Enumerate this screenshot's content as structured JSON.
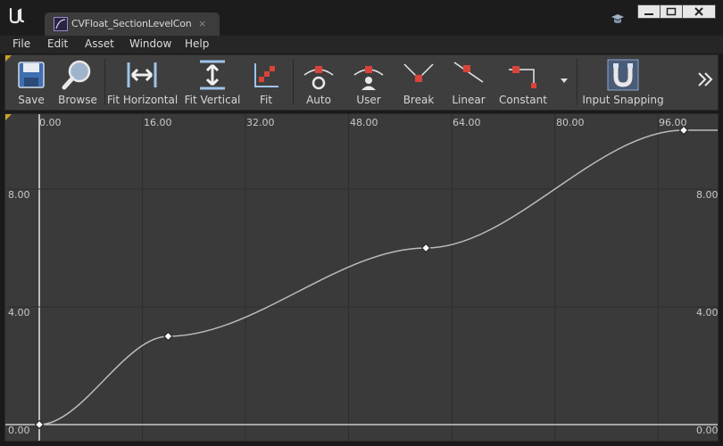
{
  "window": {
    "tab_title": "CVFloat_SectionLevelCon",
    "tab_close": "×"
  },
  "menu": [
    "File",
    "Edit",
    "Asset",
    "Window",
    "Help"
  ],
  "toolbar": {
    "save": "Save",
    "browse": "Browse",
    "fit_horizontal": "Fit Horizontal",
    "fit_vertical": "Fit Vertical",
    "fit": "Fit",
    "auto": "Auto",
    "user": "User",
    "break": "Break",
    "linear": "Linear",
    "constant": "Constant",
    "input_snapping": "Input Snapping"
  },
  "icons": {
    "logo": "unreal-logo-icon",
    "asset": "curve-asset-icon",
    "hat": "graduation-cap-icon",
    "overflow": "chevron-double-right-icon"
  },
  "colors": {
    "curve": "#bcbcbc",
    "grid": "#2e2e2e",
    "key_fill": "#ffffff",
    "accent": "#c9a227"
  },
  "chart_data": {
    "type": "line",
    "x_ticks": [
      "0.00",
      "16.00",
      "32.00",
      "48.00",
      "64.00",
      "80.00",
      "96.00"
    ],
    "y_ticks": [
      "0.00",
      "4.00",
      "8.00"
    ],
    "xlim": [
      0,
      100
    ],
    "ylim": [
      0,
      10.3
    ],
    "series": [
      {
        "keys": [
          {
            "x": 0,
            "y": 0
          },
          {
            "x": 20,
            "y": 3
          },
          {
            "x": 60,
            "y": 6
          },
          {
            "x": 100,
            "y": 10
          }
        ]
      }
    ]
  }
}
